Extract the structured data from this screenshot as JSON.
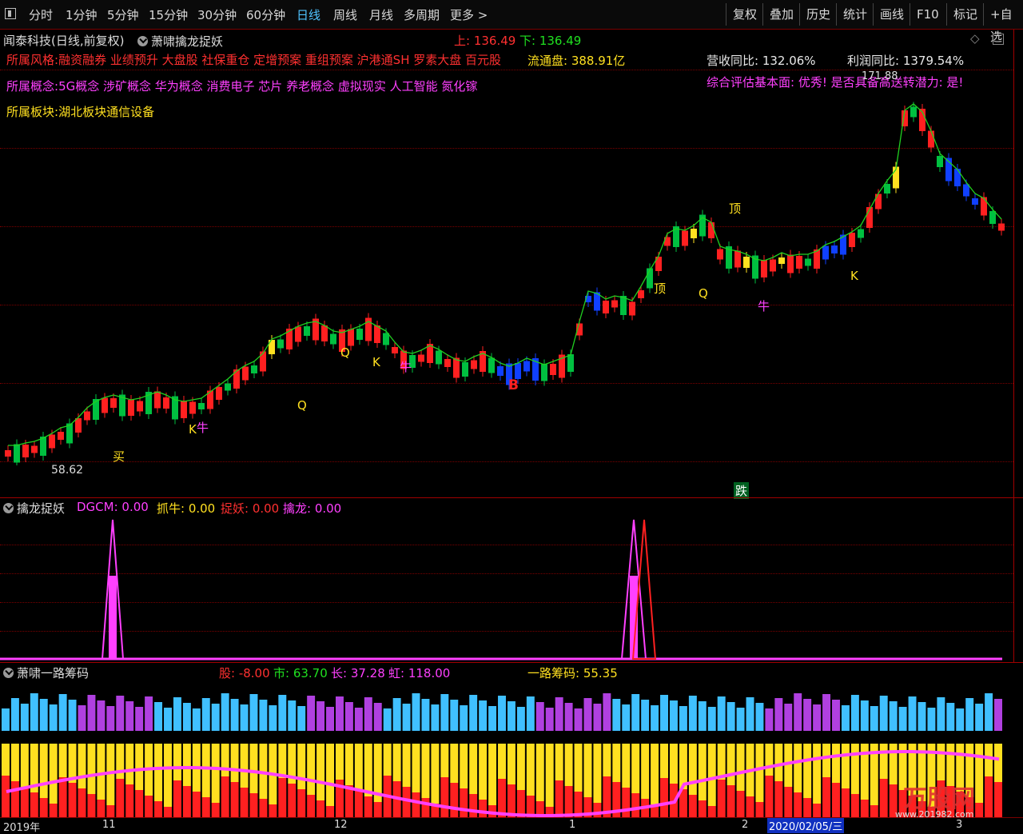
{
  "toolbar": {
    "left": [
      "分时",
      "1分钟",
      "5分钟",
      "15分钟",
      "30分钟",
      "60分钟",
      "日线",
      "周线",
      "月线",
      "多周期",
      "更多 >"
    ],
    "active": "日线",
    "right": [
      "复权",
      "叠加",
      "历史",
      "统计",
      "画线",
      "F10",
      "标记",
      "+自选"
    ]
  },
  "main": {
    "stock_title": "闻泰科技(日线,前复权)",
    "indicator_name": "萧啸擒龙捉妖",
    "upper_label": "上: 136.49",
    "lower_label": "下: 136.49",
    "row1_label": "所属风格:",
    "row1_value": "融资融券 业绩预升 大盘股 社保重仓 定增预案 重组预案 沪港通SH 罗素大盘 百元股",
    "float_cap": "流通盘: 388.91亿",
    "row2_label": "所属概念:",
    "row2_value": "5G概念 涉矿概念 华为概念 消费电子 芯片 养老概念 虚拟现实 人工智能 氮化镓",
    "row3_label": "所属板块:",
    "row3_value": "湖北板块通信设备",
    "revenue_yoy": "营收同比: 132.06%",
    "profit_yoy": "利润同比: 1379.54%",
    "high_price": "171.88",
    "low_price": "58.62",
    "eval_line": "综合评估基本面: 优秀! 是否具备高送转潜力: 是!",
    "fall_label": "跌",
    "markers": {
      "buy": "买",
      "top": "顶",
      "bull": "牛",
      "k": "K",
      "q": "Q",
      "b": "B"
    }
  },
  "panel2": {
    "name": "擒龙捉妖",
    "dgcm": "DGCM: 0.00",
    "zhuaniu": "抓牛: 0.00",
    "zhuoyao": "捉妖: 0.00",
    "qinlong": "擒龙: 0.00"
  },
  "panel3": {
    "name": "萧啸一路筹码",
    "gu": "股: -8.00",
    "shi": "市: 63.70",
    "chang": "长: 37.28",
    "hong": "虹: 118.00",
    "chouma": "一路筹码: 55.35"
  },
  "axis": {
    "year": "2019年",
    "m11": "11",
    "m12": "12",
    "m1": "1",
    "m2": "2",
    "m3": "3",
    "date_box": "2020/02/05/三"
  },
  "watermark": {
    "brand": "万股网",
    "url": "www.201982.com"
  },
  "colors": {
    "up": "#ff2020",
    "down": "#00c040",
    "blue": "#1040ff",
    "yellow": "#ffe020",
    "magenta": "#ff40ff",
    "cyan": "#40c0ff"
  }
}
